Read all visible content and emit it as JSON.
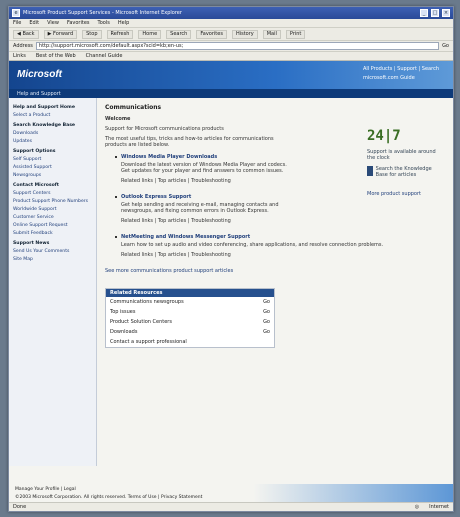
{
  "window": {
    "title": "Microsoft Product Support Services - Microsoft Internet Explorer"
  },
  "menu": [
    "File",
    "Edit",
    "View",
    "Favorites",
    "Tools",
    "Help"
  ],
  "toolbar": {
    "back_label": "Back",
    "forward_label": "Forward",
    "stop_label": "Stop",
    "refresh_label": "Refresh",
    "home_label": "Home",
    "search_label": "Search",
    "favorites_label": "Favorites",
    "history_label": "History",
    "mail_label": "Mail",
    "print_label": "Print"
  },
  "address": {
    "label": "Address",
    "value": "http://support.microsoft.com/default.aspx?scid=kb;en-us;",
    "go": "Go"
  },
  "links": [
    "Links",
    "Best of the Web",
    "Channel Guide"
  ],
  "banner": {
    "logo": "Microsoft",
    "links": [
      "All Products | Support | Search",
      "microsoft.com Guide"
    ],
    "subtitle": "Help and Support"
  },
  "sidebar": {
    "items": [
      {
        "label": "Help and Support Home",
        "sec": true
      },
      {
        "label": "Select a Product",
        "sec": false
      },
      {
        "label": "Search Knowledge Base",
        "sec": true
      },
      {
        "label": "Downloads",
        "sec": false
      },
      {
        "label": "Updates",
        "sec": false
      },
      {
        "label": "Support Options",
        "sec": true
      },
      {
        "label": "Self Support",
        "sec": false
      },
      {
        "label": "Assisted Support",
        "sec": false
      },
      {
        "label": "Newsgroups",
        "sec": false
      },
      {
        "label": "Contact Microsoft",
        "sec": true
      },
      {
        "label": "Support Centers",
        "sec": false
      },
      {
        "label": "Product Support Phone Numbers",
        "sec": false
      },
      {
        "label": "Worldwide Support",
        "sec": false
      },
      {
        "label": "Customer Service",
        "sec": false
      },
      {
        "label": "Online Support Request",
        "sec": false
      },
      {
        "label": "Submit Feedback",
        "sec": false
      },
      {
        "label": "Support News",
        "sec": true
      },
      {
        "label": "Send Us Your Comments",
        "sec": false
      },
      {
        "label": "Site Map",
        "sec": false
      }
    ]
  },
  "main": {
    "heading": "Communications",
    "intro": "Welcome",
    "p1": "Support for Microsoft communications products",
    "p2": "The most useful tips, tricks and how-to articles for communications products are listed below.",
    "bullets": [
      {
        "title": "Windows Media Player Downloads",
        "text": "Download the latest version of Windows Media Player and codecs. Get updates for your player and find answers to common issues.",
        "meta": "Related links | Top articles | Troubleshooting"
      },
      {
        "title": "Outlook Express Support",
        "text": "Get help sending and receiving e-mail, managing contacts and newsgroups, and fixing common errors in Outlook Express.",
        "meta": "Related links | Top articles | Troubleshooting"
      },
      {
        "title": "NetMeeting and Windows Messenger Support",
        "text": "Learn how to set up audio and video conferencing, share applications, and resolve connection problems.",
        "meta": "Related links | Top articles | Troubleshooting"
      }
    ],
    "more": "See more communications product support articles"
  },
  "right": {
    "clock": "24|7",
    "clock_text": "Support is available around the clock",
    "doc_text": "Search the Knowledge Base for articles",
    "link": "More product support"
  },
  "box": {
    "header": "Related Resources",
    "rows": [
      {
        "left": "Communications newsgroups",
        "right": "Go"
      },
      {
        "left": "Top issues",
        "right": "Go"
      },
      {
        "left": "Product Solution Centers",
        "right": "Go"
      },
      {
        "left": "Downloads",
        "right": "Go"
      },
      {
        "left": "Contact a support professional",
        "right": ""
      }
    ]
  },
  "footer": {
    "line1": "Manage Your Profile | Legal",
    "line2": "©2003 Microsoft Corporation. All rights reserved. Terms of Use | Privacy Statement"
  },
  "status": {
    "left": "Done",
    "right": "Internet"
  }
}
